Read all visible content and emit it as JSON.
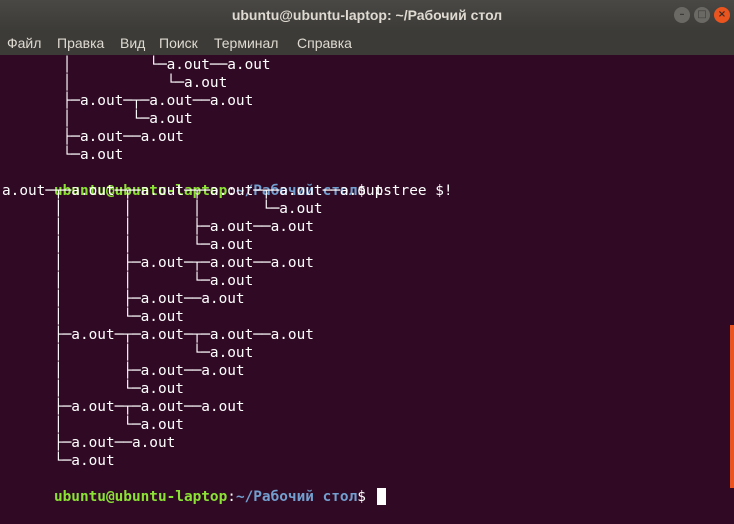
{
  "window": {
    "title": "ubuntu@ubuntu-laptop: ~/Рабочий стол"
  },
  "menu": {
    "items": [
      "Файл",
      "Правка",
      "Вид",
      "Поиск",
      "Терминал",
      "Справка"
    ]
  },
  "terminal": {
    "prompt_user": "ubuntu@ubuntu-laptop",
    "prompt_sep": ":",
    "prompt_path": "~/Рабочий стол",
    "prompt_end": "$ ",
    "command": "pstree $!",
    "tree_before": [
      "       │         └─a.out──a.out",
      "       │           └─a.out",
      "       ├─a.out─┬─a.out──a.out",
      "       │       └─a.out",
      "       ├─a.out──a.out",
      "       └─a.out"
    ],
    "tree_after": [
      "a.out─┬─a.out─┬─a.out─┬─a.out─┬─a.out──a.out",
      "      │       │       │       └─a.out",
      "      │       │       ├─a.out──a.out",
      "      │       │       └─a.out",
      "      │       ├─a.out─┬─a.out──a.out",
      "      │       │       └─a.out",
      "      │       ├─a.out──a.out",
      "      │       └─a.out",
      "      ├─a.out─┬─a.out─┬─a.out──a.out",
      "      │       │       └─a.out",
      "      │       ├─a.out──a.out",
      "      │       └─a.out",
      "      ├─a.out─┬─a.out──a.out",
      "      │       └─a.out",
      "      ├─a.out──a.out",
      "      └─a.out"
    ]
  }
}
